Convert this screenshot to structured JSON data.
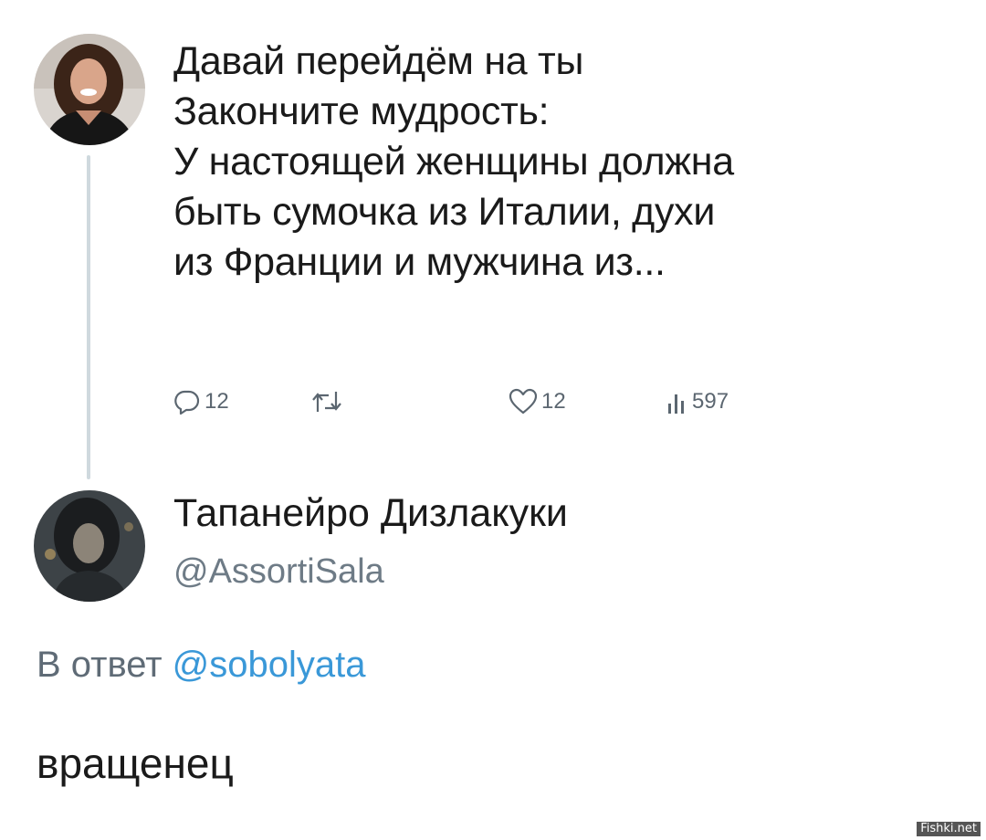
{
  "tweet": {
    "title": "Давай перейдём на ты",
    "lines": [
      "Закончите мудрость:",
      "У настоящей женщины должна",
      "быть сумочка из Италии, духи",
      "из Франции и мужчина из..."
    ],
    "replies_count": "12",
    "likes_count": "12",
    "views_count": "597",
    "icons": {
      "reply": "reply-icon",
      "retweet": "retweet-icon",
      "like": "heart-icon",
      "views": "views-bars-icon"
    }
  },
  "reply": {
    "author_name": "Тапанейро Дизлакуки",
    "author_handle": "@AssortiSala",
    "reply_to_prefix": "В ответ",
    "reply_to_mention": "@sobolyata",
    "text": "вращенец"
  },
  "watermark": "Fishki.net",
  "colors": {
    "mention": "#3a98d8",
    "muted": "#6e7b86",
    "thread_line": "#cfd9de"
  }
}
